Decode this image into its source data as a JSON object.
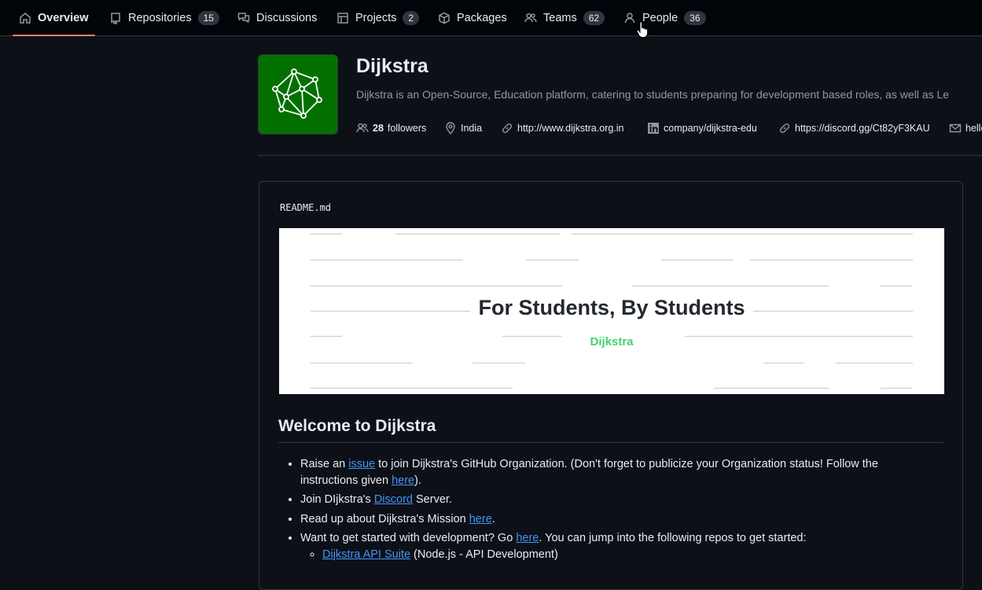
{
  "nav": {
    "tabs": [
      {
        "label": "Overview",
        "icon": "home-icon"
      },
      {
        "label": "Repositories",
        "icon": "repo-icon",
        "count": "15"
      },
      {
        "label": "Discussions",
        "icon": "discussions-icon"
      },
      {
        "label": "Projects",
        "icon": "project-icon",
        "count": "2"
      },
      {
        "label": "Packages",
        "icon": "package-icon"
      },
      {
        "label": "Teams",
        "icon": "people-icon",
        "count": "62"
      },
      {
        "label": "People",
        "icon": "person-icon",
        "count": "36"
      }
    ]
  },
  "org": {
    "name": "Dijkstra",
    "description": "Dijkstra is an Open-Source, Education platform, catering to students preparing for development based roles, as well as Le",
    "followers_count": "28",
    "followers_label": "followers",
    "location": "India",
    "website": "http://www.dijkstra.org.in",
    "linkedin": "company/dijkstra-edu",
    "discord": "https://discord.gg/Ct82yF3KAU",
    "email": "hello",
    "avatar_color": "#047000"
  },
  "readme": {
    "filename": "README.md",
    "banner_title": "For Students, By Students",
    "banner_subtitle": "Dijkstra",
    "heading": "Welcome to Dijkstra",
    "items": {
      "item1_pre": "Raise an ",
      "item1_link": "issue",
      "item1_mid": " to join Dijkstra's GitHub Organization. (Don't forget to publicize your Organization status! Follow the instructions given ",
      "item1_link2": "here",
      "item1_post": ").",
      "item2_pre": "Join DIjkstra's ",
      "item2_link": "Discord",
      "item2_post": " Server.",
      "item3_pre": "Read up about Dijkstra's Mission ",
      "item3_link": "here",
      "item3_post": ".",
      "item4_pre": "Want to get started with development? Go ",
      "item4_link": "here",
      "item4_post": ". You can jump into the following repos to get started:",
      "sub1_link": "Dijkstra API Suite",
      "sub1_post": " (Node.js - API Development)"
    }
  },
  "colors": {
    "accent_underline": "#f78166",
    "link": "#4493f8",
    "banner_sub": "#43d36b"
  }
}
